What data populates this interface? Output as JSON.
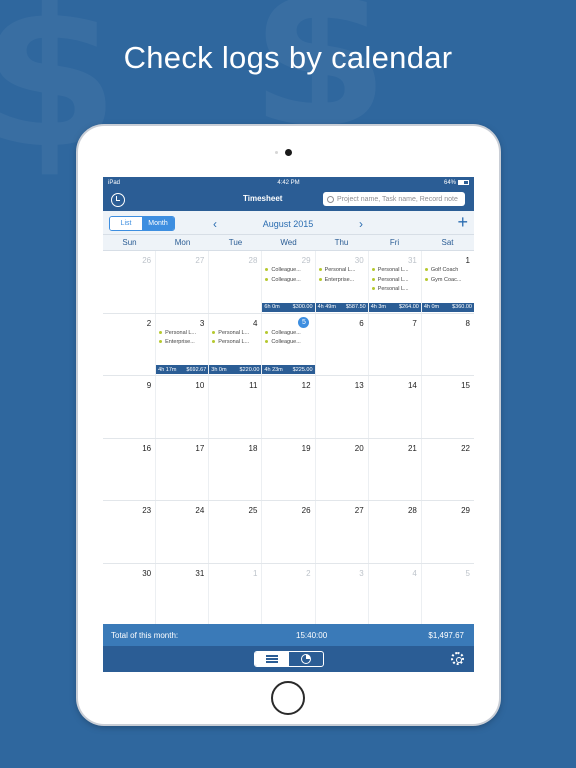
{
  "headline": "Check logs by calendar",
  "status_bar": {
    "carrier": "iPad",
    "time": "4:42 PM",
    "battery": "64%"
  },
  "nav": {
    "title": "Timesheet",
    "search_placeholder": "Project name, Task name, Record note"
  },
  "toolbar": {
    "list_label": "List",
    "month_label": "Month",
    "current_month": "August 2015",
    "prev_icon": "chevron-left-icon",
    "next_icon": "chevron-right-icon",
    "add_icon": "plus-icon"
  },
  "weekdays": [
    "Sun",
    "Mon",
    "Tue",
    "Wed",
    "Thu",
    "Fri",
    "Sat"
  ],
  "weeks": [
    {
      "days": [
        {
          "num": "26",
          "muted": true
        },
        {
          "num": "27",
          "muted": true
        },
        {
          "num": "28",
          "muted": true
        },
        {
          "num": "29",
          "muted": true,
          "entries": [
            "Colleague...",
            "Colleague..."
          ],
          "hours": "6h 0m",
          "amount": "$300.00"
        },
        {
          "num": "30",
          "muted": true,
          "entries": [
            "Personal L...",
            "Enterprise..."
          ],
          "hours": "4h 49m",
          "amount": "$587.50"
        },
        {
          "num": "31",
          "muted": true,
          "entries": [
            "Personal L...",
            "Personal L...",
            "Personal L..."
          ],
          "hours": "4h 3m",
          "amount": "$264.00"
        },
        {
          "num": "1",
          "entries": [
            "Golf Coach",
            "Gym Coac..."
          ],
          "hours": "4h 0m",
          "amount": "$360.00"
        }
      ]
    },
    {
      "days": [
        {
          "num": "2"
        },
        {
          "num": "3",
          "entries": [
            "Personal L...",
            "Enterprise..."
          ],
          "hours": "4h 17m",
          "amount": "$692.67"
        },
        {
          "num": "4",
          "entries": [
            "Personal L...",
            "Personal L..."
          ],
          "hours": "3h 0m",
          "amount": "$220.00"
        },
        {
          "num": "5",
          "today": true,
          "entries": [
            "Colleague...",
            "Colleague..."
          ],
          "hours": "4h 23m",
          "amount": "$225.00"
        },
        {
          "num": "6"
        },
        {
          "num": "7"
        },
        {
          "num": "8"
        }
      ]
    },
    {
      "days": [
        {
          "num": "9"
        },
        {
          "num": "10"
        },
        {
          "num": "11"
        },
        {
          "num": "12"
        },
        {
          "num": "13"
        },
        {
          "num": "14"
        },
        {
          "num": "15"
        }
      ]
    },
    {
      "days": [
        {
          "num": "16"
        },
        {
          "num": "17"
        },
        {
          "num": "18"
        },
        {
          "num": "19"
        },
        {
          "num": "20"
        },
        {
          "num": "21"
        },
        {
          "num": "22"
        }
      ]
    },
    {
      "days": [
        {
          "num": "23"
        },
        {
          "num": "24"
        },
        {
          "num": "25"
        },
        {
          "num": "26"
        },
        {
          "num": "27"
        },
        {
          "num": "28"
        },
        {
          "num": "29"
        }
      ]
    },
    {
      "days": [
        {
          "num": "30"
        },
        {
          "num": "31"
        },
        {
          "num": "1",
          "muted": true
        },
        {
          "num": "2",
          "muted": true
        },
        {
          "num": "3",
          "muted": true
        },
        {
          "num": "4",
          "muted": true
        },
        {
          "num": "5",
          "muted": true
        }
      ]
    }
  ],
  "footer": {
    "total_label": "Total of this month:",
    "total_time": "15:40:00",
    "total_amount": "$1,497.67"
  },
  "colors": {
    "background": "#2f679e",
    "nav_blue": "#2b5d95",
    "accent": "#3d8ee0",
    "entry_dot": "#b5c92f"
  }
}
